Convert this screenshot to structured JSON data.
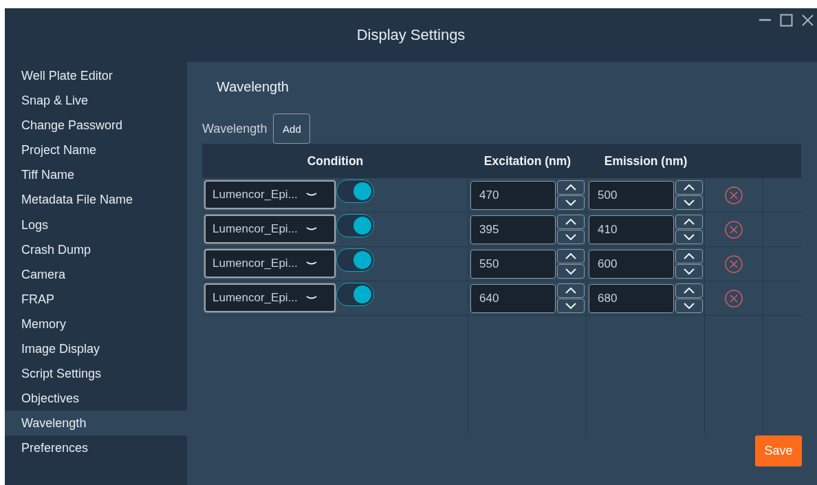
{
  "window": {
    "title": "Display Settings"
  },
  "sidebar": {
    "items": [
      {
        "label": "Well Plate Editor",
        "selected": false
      },
      {
        "label": "Snap & Live",
        "selected": false
      },
      {
        "label": "Change Password",
        "selected": false
      },
      {
        "label": "Project Name",
        "selected": false
      },
      {
        "label": "Tiff Name",
        "selected": false
      },
      {
        "label": "Metadata File Name",
        "selected": false
      },
      {
        "label": "Logs",
        "selected": false
      },
      {
        "label": "Crash Dump",
        "selected": false
      },
      {
        "label": "Camera",
        "selected": false
      },
      {
        "label": "FRAP",
        "selected": false
      },
      {
        "label": "Memory",
        "selected": false
      },
      {
        "label": "Image Display",
        "selected": false
      },
      {
        "label": "Script Settings",
        "selected": false
      },
      {
        "label": "Objectives",
        "selected": false
      },
      {
        "label": "Wavelength",
        "selected": true
      },
      {
        "label": "Preferences",
        "selected": false
      }
    ]
  },
  "panel": {
    "heading": "Wavelength",
    "add_label": "Wavelength",
    "add_button": "Add",
    "table": {
      "columns": [
        "Condition",
        "Excitation (nm)",
        "Emission (nm)"
      ],
      "rows": [
        {
          "condition": "Lumencor_Epi...",
          "enabled": true,
          "excitation": "470",
          "emission": "500"
        },
        {
          "condition": "Lumencor_Epi...",
          "enabled": true,
          "excitation": "395",
          "emission": "410"
        },
        {
          "condition": "Lumencor_Epi...",
          "enabled": true,
          "excitation": "550",
          "emission": "600"
        },
        {
          "condition": "Lumencor_Epi...",
          "enabled": true,
          "excitation": "640",
          "emission": "680"
        }
      ]
    },
    "save_button": "Save"
  }
}
